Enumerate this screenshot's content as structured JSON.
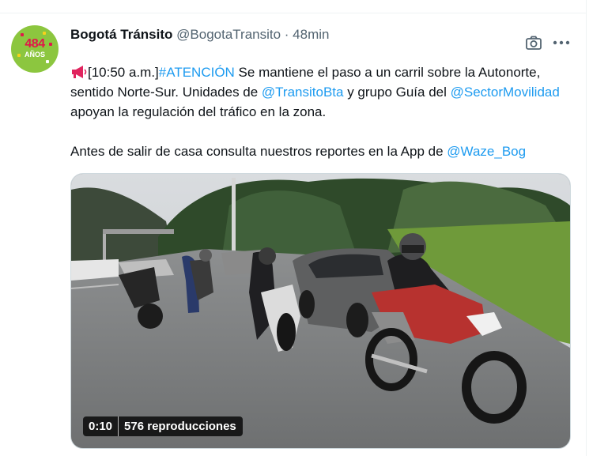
{
  "tweet": {
    "author_name": "Bogotá Tránsito",
    "author_handle": "@BogotaTransito",
    "separator": " · ",
    "time_ago": "48min",
    "avatar": {
      "number": "484",
      "sub": "AÑOS"
    },
    "icons": {
      "camera": "camera-icon",
      "more": "more-icon",
      "megaphone": "megaphone-icon"
    },
    "text": {
      "time": "[10:50 a.m.]",
      "hashtag": "#ATENCIÓN",
      "part1": " Se mantiene el paso a un carril sobre la Autonorte, sentido Norte-Sur. Unidades de ",
      "mention1": "@TransitoBta",
      "part2": " y grupo Guía del ",
      "mention2": "@SectorMovilidad",
      "part3": " apoyan la regulación del tráfico en la zona.",
      "line2": "Antes de salir de casa consulta nuestros reportes en la App de ",
      "mention3": "@Waze_Bog"
    },
    "video": {
      "duration": "0:10",
      "views": "576 reproducciones"
    }
  },
  "colors": {
    "link": "#1d9bf0",
    "text": "#0f1419",
    "muted": "#536471",
    "avatar_bg": "#8cc63f"
  }
}
